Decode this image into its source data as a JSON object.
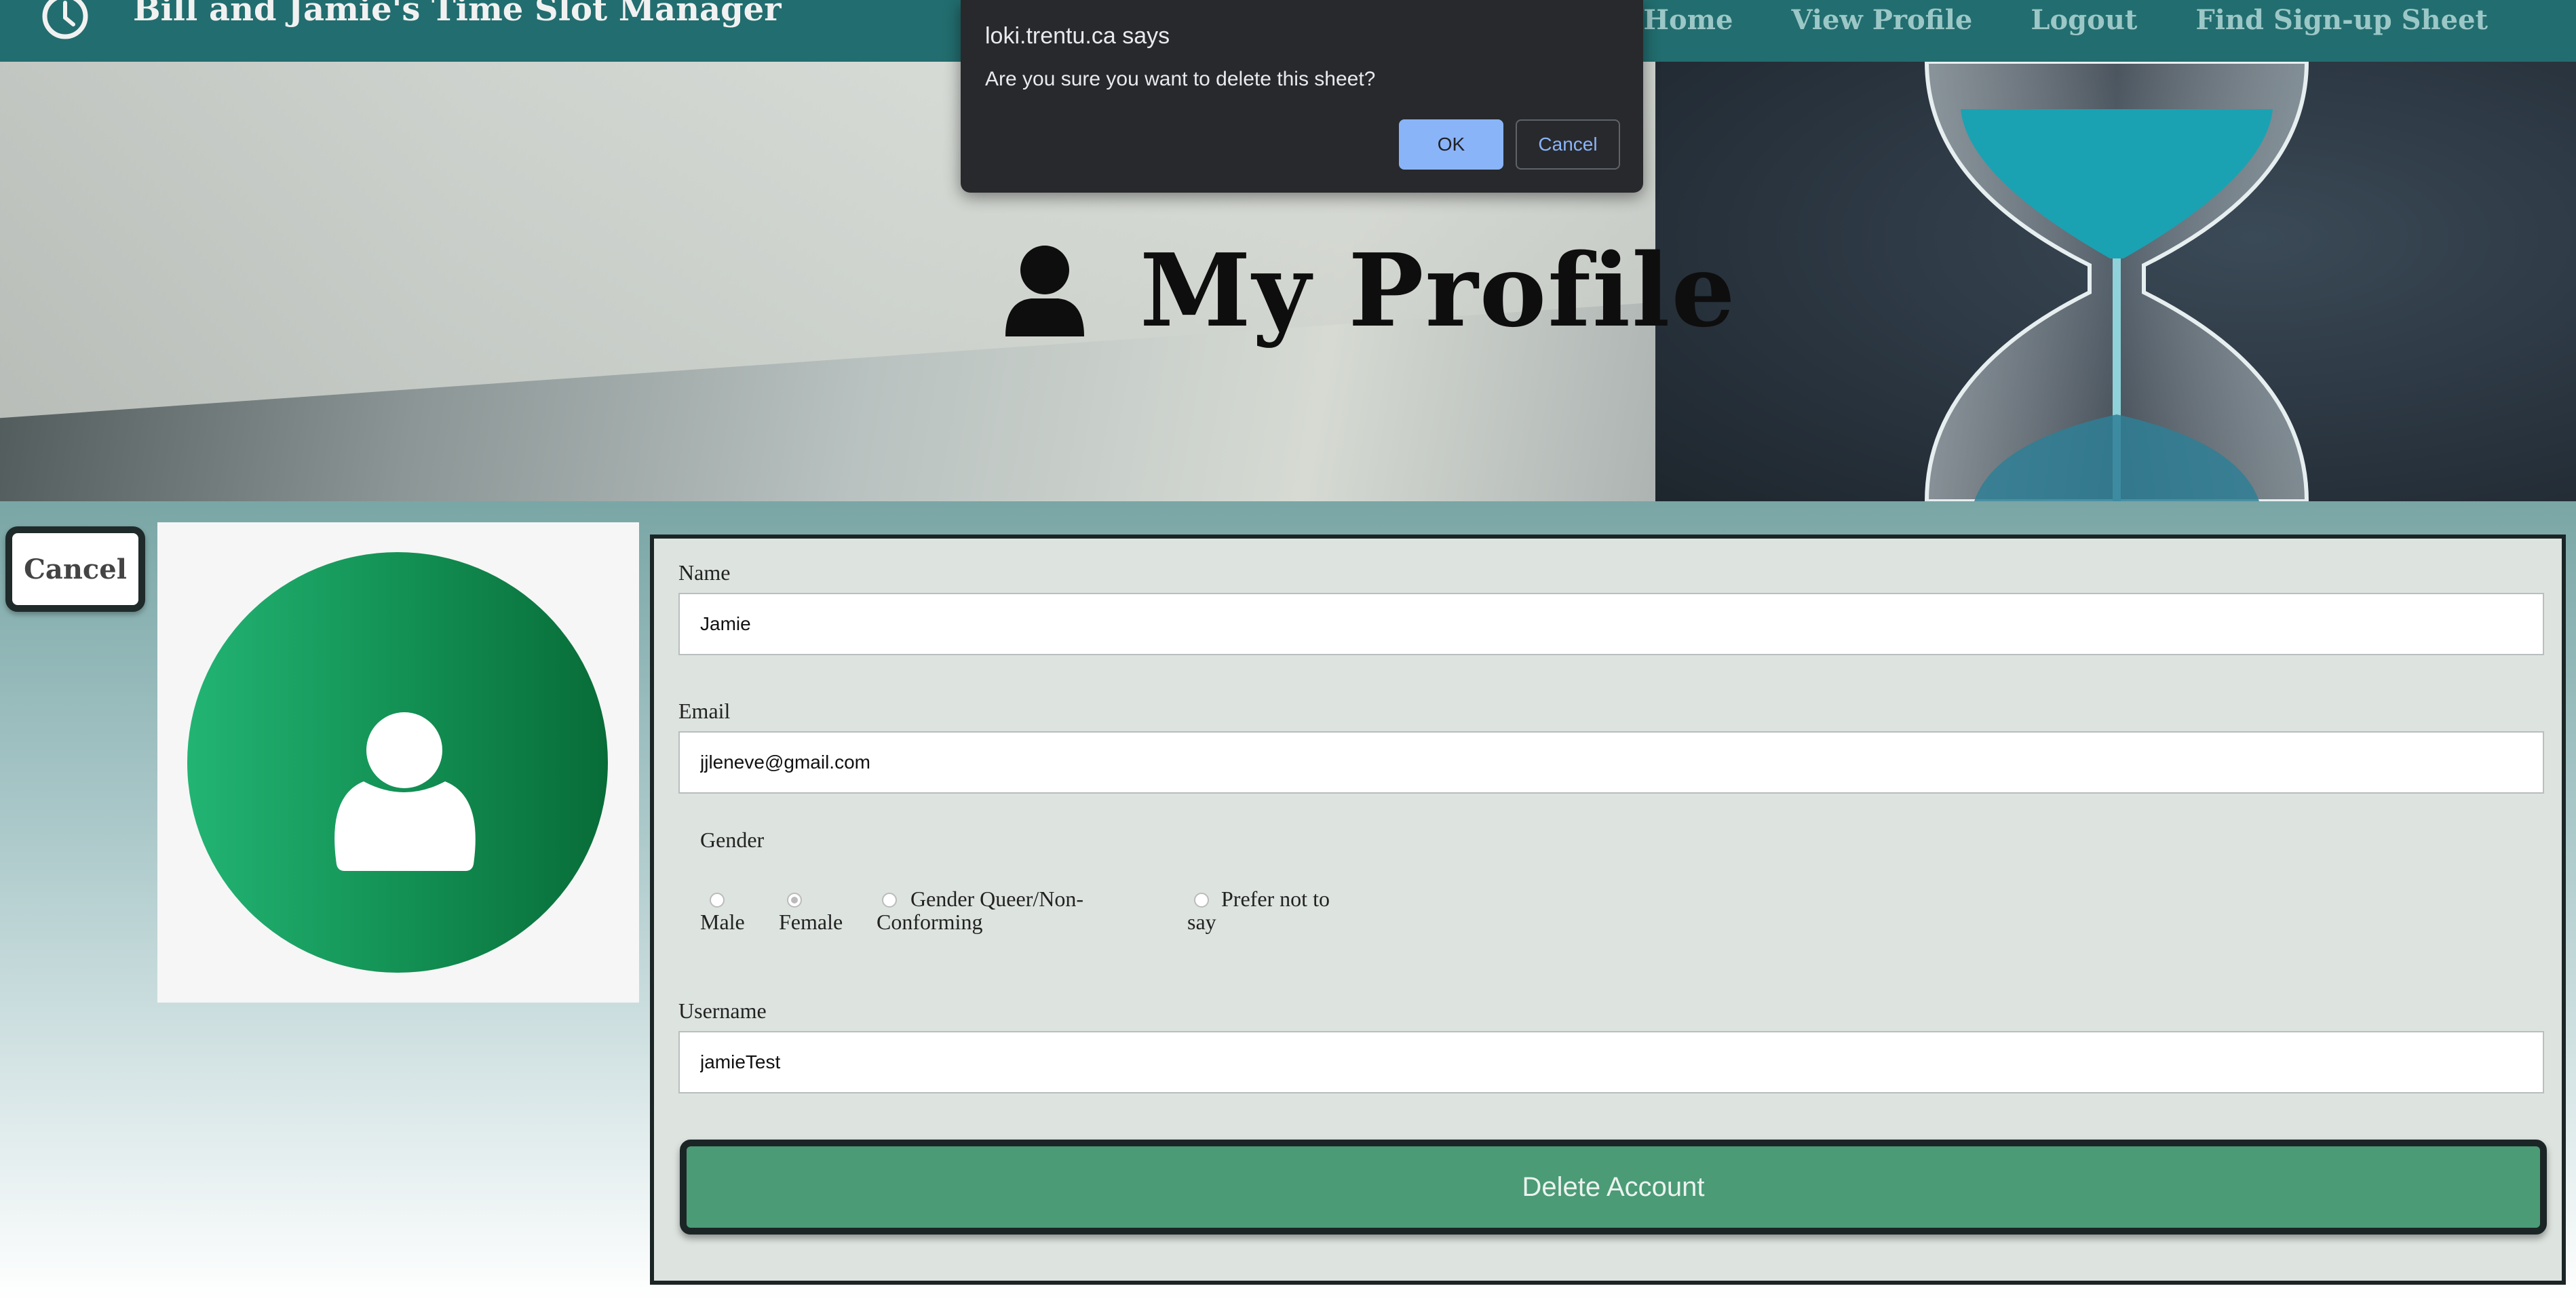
{
  "nav": {
    "brand": "Bill and Jamie's Time Slot Manager",
    "links": [
      "Home",
      "View Profile",
      "Logout",
      "Find Sign-up Sheet"
    ]
  },
  "hero": {
    "title": "My Profile"
  },
  "dialog": {
    "origin": "loki.trentu.ca says",
    "message": "Are you sure you want to delete this sheet?",
    "ok": "OK",
    "cancel": "Cancel"
  },
  "left": {
    "cancel": "Cancel"
  },
  "form": {
    "name_label": "Name",
    "name_value": "Jamie",
    "email_label": "Email",
    "email_value": "jjleneve@gmail.com",
    "gender_label": "Gender",
    "gender_options": [
      "Male",
      "Female",
      "Gender Queer/Non-Conforming",
      "Prefer not to say"
    ],
    "gender_selected": "Female",
    "username_label": "Username",
    "username_value": "jamieTest",
    "delete_button": "Delete Account"
  },
  "colors": {
    "nav_bg": "#226d6f",
    "nav_link": "#9cc7c7",
    "delete_btn": "#4a9b76",
    "dialog_ok": "#8ab4f8",
    "avatar_green": "#1aa263"
  }
}
